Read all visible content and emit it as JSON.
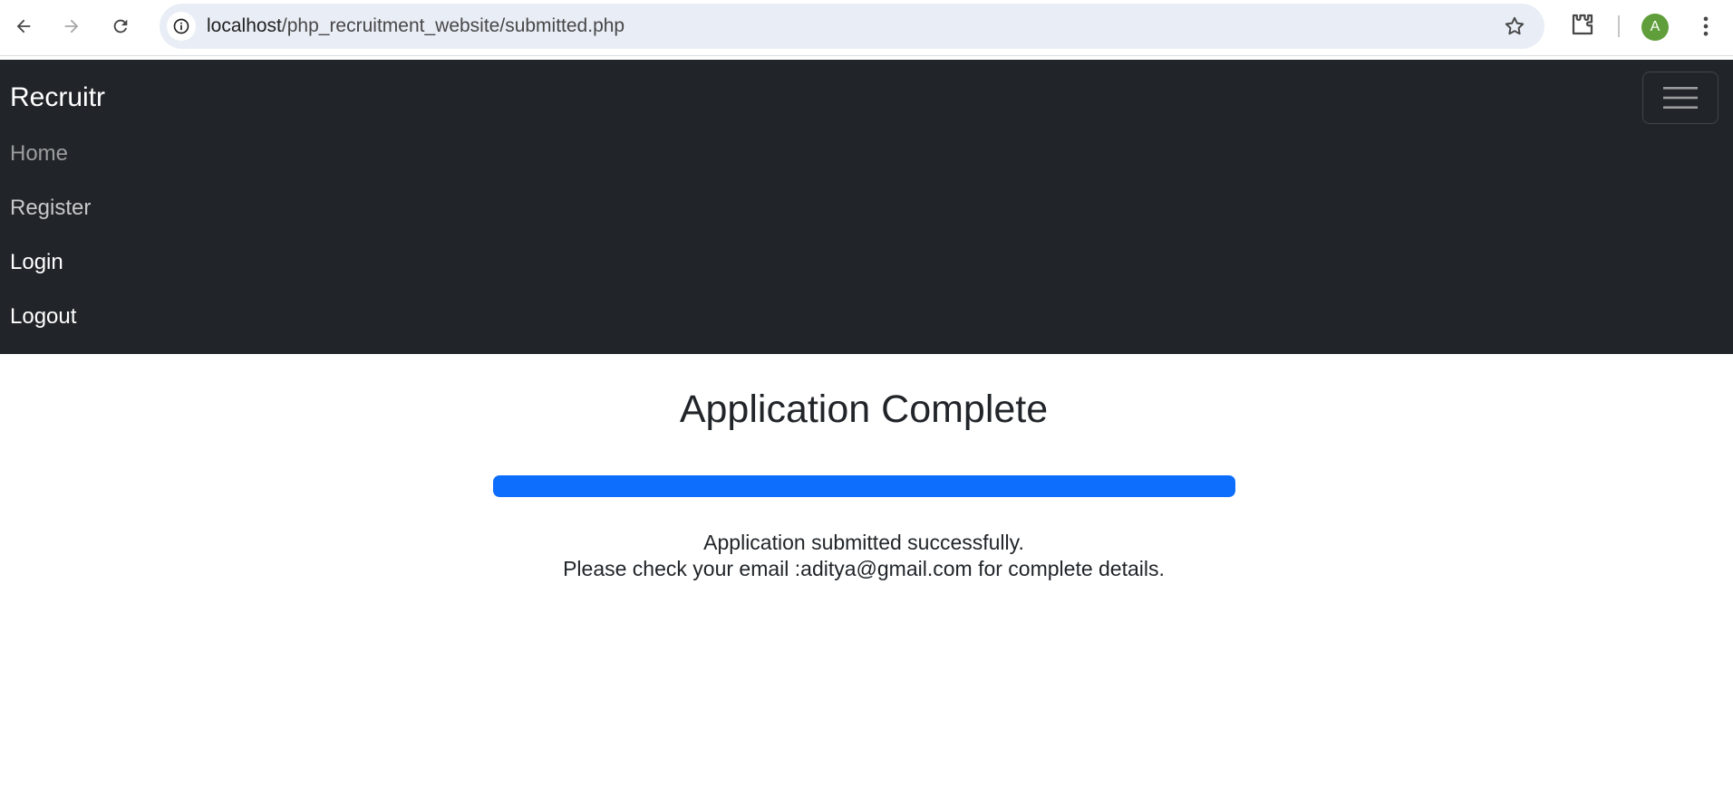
{
  "browser": {
    "url_host": "localhost",
    "url_path": "/php_recruitment_website/submitted.php",
    "profile_initial": "A"
  },
  "navbar": {
    "brand": "Recruitr",
    "links": [
      {
        "label": "Home"
      },
      {
        "label": "Register"
      },
      {
        "label": "Login"
      },
      {
        "label": "Logout"
      }
    ]
  },
  "main": {
    "title": "Application Complete",
    "progress_percent": 100,
    "message_line1": "Application submitted successfully.",
    "message_line2": "Please check your email :aditya@gmail.com for complete details."
  },
  "colors": {
    "navbar_bg": "#212529",
    "progress_fill": "#0d6efd",
    "avatar_bg": "#5f9e3a"
  },
  "icons": [
    "back-arrow-icon",
    "forward-arrow-icon",
    "reload-icon",
    "site-info-icon",
    "bookmark-star-icon",
    "extensions-icon",
    "kebab-menu-icon",
    "hamburger-icon"
  ]
}
